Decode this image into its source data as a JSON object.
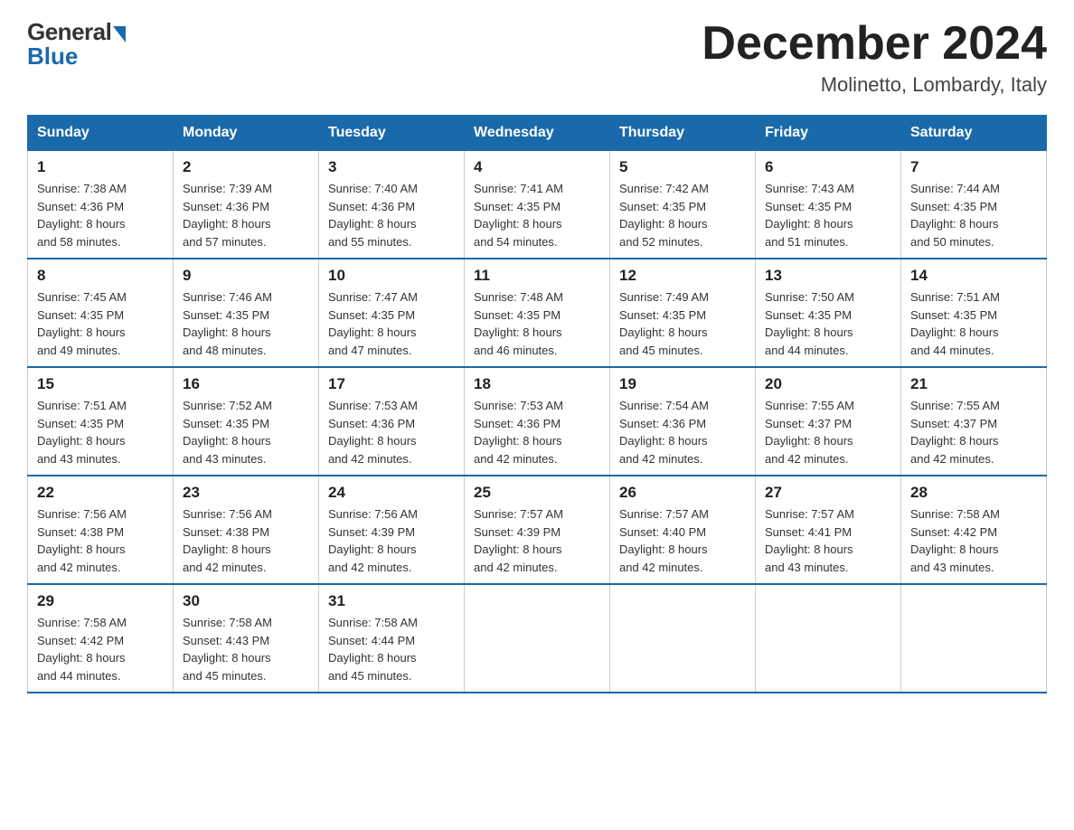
{
  "header": {
    "logo_general": "General",
    "logo_blue": "Blue",
    "month_title": "December 2024",
    "location": "Molinetto, Lombardy, Italy"
  },
  "days_of_week": [
    "Sunday",
    "Monday",
    "Tuesday",
    "Wednesday",
    "Thursday",
    "Friday",
    "Saturday"
  ],
  "weeks": [
    [
      {
        "day": "1",
        "sunrise": "7:38 AM",
        "sunset": "4:36 PM",
        "daylight": "8 hours and 58 minutes."
      },
      {
        "day": "2",
        "sunrise": "7:39 AM",
        "sunset": "4:36 PM",
        "daylight": "8 hours and 57 minutes."
      },
      {
        "day": "3",
        "sunrise": "7:40 AM",
        "sunset": "4:36 PM",
        "daylight": "8 hours and 55 minutes."
      },
      {
        "day": "4",
        "sunrise": "7:41 AM",
        "sunset": "4:35 PM",
        "daylight": "8 hours and 54 minutes."
      },
      {
        "day": "5",
        "sunrise": "7:42 AM",
        "sunset": "4:35 PM",
        "daylight": "8 hours and 52 minutes."
      },
      {
        "day": "6",
        "sunrise": "7:43 AM",
        "sunset": "4:35 PM",
        "daylight": "8 hours and 51 minutes."
      },
      {
        "day": "7",
        "sunrise": "7:44 AM",
        "sunset": "4:35 PM",
        "daylight": "8 hours and 50 minutes."
      }
    ],
    [
      {
        "day": "8",
        "sunrise": "7:45 AM",
        "sunset": "4:35 PM",
        "daylight": "8 hours and 49 minutes."
      },
      {
        "day": "9",
        "sunrise": "7:46 AM",
        "sunset": "4:35 PM",
        "daylight": "8 hours and 48 minutes."
      },
      {
        "day": "10",
        "sunrise": "7:47 AM",
        "sunset": "4:35 PM",
        "daylight": "8 hours and 47 minutes."
      },
      {
        "day": "11",
        "sunrise": "7:48 AM",
        "sunset": "4:35 PM",
        "daylight": "8 hours and 46 minutes."
      },
      {
        "day": "12",
        "sunrise": "7:49 AM",
        "sunset": "4:35 PM",
        "daylight": "8 hours and 45 minutes."
      },
      {
        "day": "13",
        "sunrise": "7:50 AM",
        "sunset": "4:35 PM",
        "daylight": "8 hours and 44 minutes."
      },
      {
        "day": "14",
        "sunrise": "7:51 AM",
        "sunset": "4:35 PM",
        "daylight": "8 hours and 44 minutes."
      }
    ],
    [
      {
        "day": "15",
        "sunrise": "7:51 AM",
        "sunset": "4:35 PM",
        "daylight": "8 hours and 43 minutes."
      },
      {
        "day": "16",
        "sunrise": "7:52 AM",
        "sunset": "4:35 PM",
        "daylight": "8 hours and 43 minutes."
      },
      {
        "day": "17",
        "sunrise": "7:53 AM",
        "sunset": "4:36 PM",
        "daylight": "8 hours and 42 minutes."
      },
      {
        "day": "18",
        "sunrise": "7:53 AM",
        "sunset": "4:36 PM",
        "daylight": "8 hours and 42 minutes."
      },
      {
        "day": "19",
        "sunrise": "7:54 AM",
        "sunset": "4:36 PM",
        "daylight": "8 hours and 42 minutes."
      },
      {
        "day": "20",
        "sunrise": "7:55 AM",
        "sunset": "4:37 PM",
        "daylight": "8 hours and 42 minutes."
      },
      {
        "day": "21",
        "sunrise": "7:55 AM",
        "sunset": "4:37 PM",
        "daylight": "8 hours and 42 minutes."
      }
    ],
    [
      {
        "day": "22",
        "sunrise": "7:56 AM",
        "sunset": "4:38 PM",
        "daylight": "8 hours and 42 minutes."
      },
      {
        "day": "23",
        "sunrise": "7:56 AM",
        "sunset": "4:38 PM",
        "daylight": "8 hours and 42 minutes."
      },
      {
        "day": "24",
        "sunrise": "7:56 AM",
        "sunset": "4:39 PM",
        "daylight": "8 hours and 42 minutes."
      },
      {
        "day": "25",
        "sunrise": "7:57 AM",
        "sunset": "4:39 PM",
        "daylight": "8 hours and 42 minutes."
      },
      {
        "day": "26",
        "sunrise": "7:57 AM",
        "sunset": "4:40 PM",
        "daylight": "8 hours and 42 minutes."
      },
      {
        "day": "27",
        "sunrise": "7:57 AM",
        "sunset": "4:41 PM",
        "daylight": "8 hours and 43 minutes."
      },
      {
        "day": "28",
        "sunrise": "7:58 AM",
        "sunset": "4:42 PM",
        "daylight": "8 hours and 43 minutes."
      }
    ],
    [
      {
        "day": "29",
        "sunrise": "7:58 AM",
        "sunset": "4:42 PM",
        "daylight": "8 hours and 44 minutes."
      },
      {
        "day": "30",
        "sunrise": "7:58 AM",
        "sunset": "4:43 PM",
        "daylight": "8 hours and 45 minutes."
      },
      {
        "day": "31",
        "sunrise": "7:58 AM",
        "sunset": "4:44 PM",
        "daylight": "8 hours and 45 minutes."
      },
      null,
      null,
      null,
      null
    ]
  ],
  "labels": {
    "sunrise": "Sunrise:",
    "sunset": "Sunset:",
    "daylight": "Daylight:"
  }
}
